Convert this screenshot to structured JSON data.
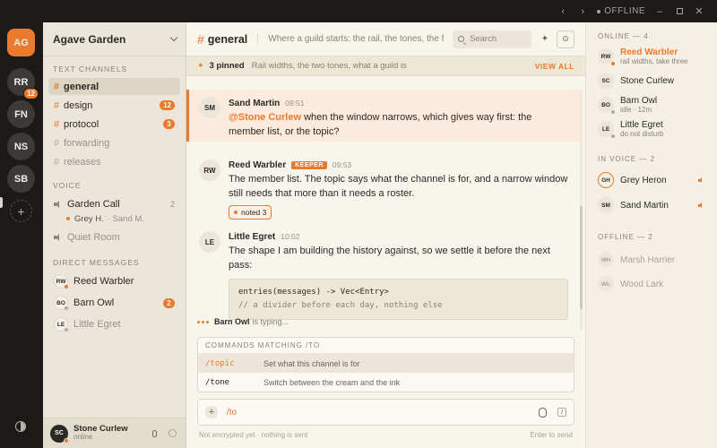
{
  "titlebar": {
    "status": "OFFLINE"
  },
  "guilds": [
    {
      "abbr": "AG",
      "active": true
    },
    {
      "abbr": "RR",
      "badge": "12"
    },
    {
      "abbr": "FN"
    },
    {
      "abbr": "NS"
    },
    {
      "abbr": "SB"
    }
  ],
  "guild_add": "+",
  "sidebar": {
    "guild_name": "Agave Garden",
    "text_title": "TEXT CHANNELS",
    "channels": [
      {
        "name": "general",
        "active": true
      },
      {
        "name": "design",
        "badge": "12"
      },
      {
        "name": "protocol",
        "badge": "3"
      },
      {
        "name": "forwarding",
        "muted": true
      },
      {
        "name": "releases",
        "muted": true
      }
    ],
    "voice_title": "VOICE",
    "voice": {
      "garden_call": "Garden Call",
      "garden_count": "2",
      "member": "Grey H.",
      "member_extra": "· Sand M.",
      "quiet_room": "Quiet Room"
    },
    "dm_title": "DIRECT MESSAGES",
    "dms": [
      {
        "abbr": "RW",
        "name": "Reed Warbler",
        "presence": "#ea7a2d"
      },
      {
        "abbr": "BO",
        "name": "Barn Owl",
        "badge": "2",
        "presence": "#b0aca3"
      },
      {
        "abbr": "LE",
        "name": "Little Egret",
        "presence": "#b0aca3",
        "muted": true
      }
    ],
    "me": {
      "abbr": "SC",
      "name": "Stone Curlew",
      "status": "online"
    }
  },
  "main": {
    "channel": "general",
    "topic": "Where a guild starts: the rail, the tones, the first...",
    "search_placeholder": "Search",
    "pinned_count": "3 pinned",
    "pinned_text": "Rail widths, the two tones, what a guild is",
    "view_all": "VIEW ALL",
    "messages": [
      {
        "abbr": "SM",
        "author": "Sand Martin",
        "time": "09:51",
        "mention": "@Stone Curlew",
        "text": " when the window narrows, which gives way first: the member list, or the topic?"
      },
      {
        "abbr": "RW",
        "author": "Reed Warbler",
        "role": "KEEPER",
        "time": "09:53",
        "text": "The member list. The topic says what the channel is for, and a narrow window still needs that more than it needs a roster.",
        "reaction": "noted 3"
      },
      {
        "abbr": "LE",
        "author": "Little Egret",
        "time": "10:02",
        "text": "The shape I am building the history against, so we settle it before the next pass:",
        "code1": "entries(messages) -> Vec<Entry>",
        "code2": "// a divider before each day, nothing else"
      }
    ],
    "typing_who": "Barn Owl",
    "typing_text": "is typing...",
    "commands_title": "COMMANDS MATCHING /TO",
    "commands": [
      {
        "name": "/topic",
        "desc": "Set what this channel is for"
      },
      {
        "name": "/tone",
        "desc": "Switch between the cream and the ink"
      }
    ],
    "composer_value": "/to",
    "footer_left": "Not encrypted yet · nothing is sent",
    "footer_right": "Enter to send"
  },
  "members": {
    "online_title": "ONLINE — 4",
    "online": [
      {
        "abbr": "RW",
        "name": "Reed Warbler",
        "status": "rail widths, take three",
        "accent": true,
        "presence": "#ea7a2d"
      },
      {
        "abbr": "SC",
        "name": "Stone Curlew",
        "presence": "#ea7a2d"
      },
      {
        "abbr": "BO",
        "name": "Barn Owl",
        "status": "idle · 12m",
        "presence": "#b0aca3"
      },
      {
        "abbr": "LE",
        "name": "Little Egret",
        "status": "do not disturb",
        "presence": "#b0aca3"
      }
    ],
    "voice_title": "IN VOICE — 2",
    "voice": [
      {
        "abbr": "GH",
        "name": "Grey Heron"
      },
      {
        "abbr": "SM",
        "name": "Sand Martin"
      }
    ],
    "offline_title": "OFFLINE — 2",
    "offline": [
      {
        "abbr": "MH",
        "name": "Marsh Harrier"
      },
      {
        "abbr": "WL",
        "name": "Wood Lark"
      }
    ]
  }
}
